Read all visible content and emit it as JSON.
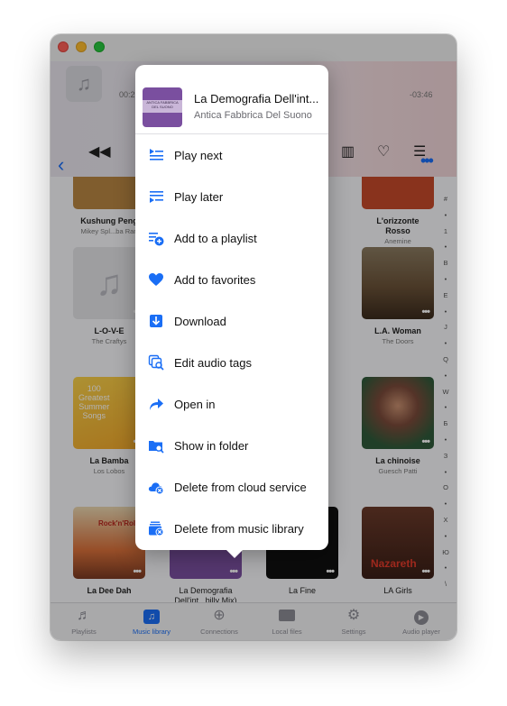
{
  "player": {
    "time_elapsed": "00:2",
    "time_remaining": "-03:46",
    "icons": [
      "music-note-icon",
      "rewind-icon",
      "columns-icon",
      "heart-icon",
      "menu-icon",
      "back-chevron-icon",
      "more-icon"
    ]
  },
  "albums": [
    {
      "title": "Kushung Peng",
      "artist": "Mikey Spl...ba Ran",
      "color": "#b88642"
    },
    {
      "title": "L'orizzonte\nRosso",
      "artist": "Anemine",
      "color": "#c44a2a"
    },
    {
      "title": "L-O-V-E",
      "artist": "The Craftys",
      "color": "#d8d8dc"
    },
    {
      "title": "L.A. Woman",
      "artist": "The Doors",
      "color": "#8a6a4a"
    },
    {
      "title": "La Bamba",
      "artist": "Los Lobos",
      "color": "#f4c02a"
    },
    {
      "title": "La chinoise",
      "artist": "Guesch Patti",
      "color": "#2f5a3a"
    },
    {
      "title": "La Dee Dah",
      "artist": "",
      "color": "#d8703a"
    },
    {
      "title": "La Demografia\nDell'int...billy Mix)",
      "artist": "",
      "color": "#7a4f9f"
    },
    {
      "title": "La Fine",
      "artist": "",
      "color": "#111111"
    },
    {
      "title": "LA Girls",
      "artist": "",
      "color": "#5a2a1e"
    }
  ],
  "cover_texts": {
    "bamba": "100\nGreatest\nSummer\nSongs",
    "deedah": "Rock'n'Rol",
    "lagirls": "Nazareth"
  },
  "index_letters": [
    "#",
    "•",
    "1",
    "•",
    "B",
    "•",
    "E",
    "•",
    "J",
    "•",
    "Q",
    "•",
    "W",
    "•",
    "Б",
    "•",
    "З",
    "•",
    "О",
    "•",
    "Х",
    "•",
    "Ю",
    "•",
    "\\"
  ],
  "tabs": [
    {
      "label": "Playlists",
      "icon": "playlists-icon",
      "active": false
    },
    {
      "label": "Music library",
      "icon": "music-library-icon",
      "active": true
    },
    {
      "label": "Connections",
      "icon": "globe-icon",
      "active": false
    },
    {
      "label": "Local files",
      "icon": "folder-icon",
      "active": false
    },
    {
      "label": "Settings",
      "icon": "gear-icon",
      "active": false
    },
    {
      "label": "Audio player",
      "icon": "play-icon",
      "active": false
    }
  ],
  "context_menu": {
    "title": "La Demografia Dell'int...",
    "subtitle": "Antica Fabbrica Del Suono",
    "art_text": "ANTICA FABBRICA\nDEL SUONO",
    "items": [
      {
        "label": "Play next",
        "icon": "play-next-icon"
      },
      {
        "label": "Play later",
        "icon": "play-later-icon"
      },
      {
        "label": "Add to a playlist",
        "icon": "add-to-playlist-icon"
      },
      {
        "label": "Add to favorites",
        "icon": "heart-icon"
      },
      {
        "label": "Download",
        "icon": "download-icon"
      },
      {
        "label": "Edit audio tags",
        "icon": "edit-tags-icon"
      },
      {
        "label": "Open in",
        "icon": "share-arrow-icon"
      },
      {
        "label": "Show in folder",
        "icon": "folder-search-icon"
      },
      {
        "label": "Delete from cloud service",
        "icon": "cloud-delete-icon"
      },
      {
        "label": "Delete from music library",
        "icon": "library-delete-icon"
      }
    ]
  },
  "colors": {
    "accent": "#1a6ef5"
  }
}
